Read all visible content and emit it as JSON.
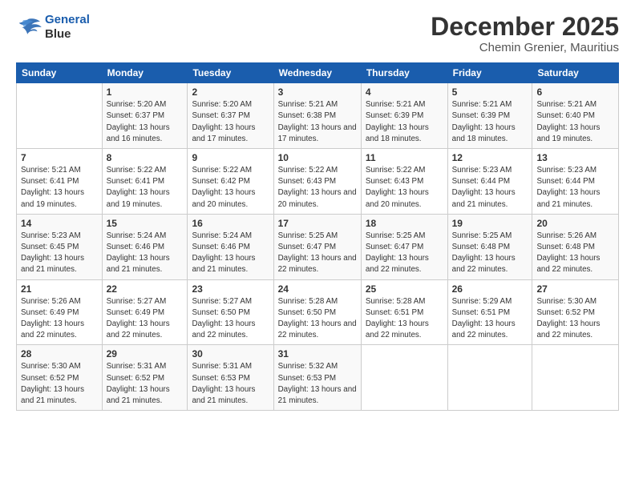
{
  "logo": {
    "line1": "General",
    "line2": "Blue"
  },
  "title": "December 2025",
  "subtitle": "Chemin Grenier, Mauritius",
  "days_of_week": [
    "Sunday",
    "Monday",
    "Tuesday",
    "Wednesday",
    "Thursday",
    "Friday",
    "Saturday"
  ],
  "weeks": [
    [
      {
        "num": "",
        "sunrise": "",
        "sunset": "",
        "daylight": ""
      },
      {
        "num": "1",
        "sunrise": "Sunrise: 5:20 AM",
        "sunset": "Sunset: 6:37 PM",
        "daylight": "Daylight: 13 hours and 16 minutes."
      },
      {
        "num": "2",
        "sunrise": "Sunrise: 5:20 AM",
        "sunset": "Sunset: 6:37 PM",
        "daylight": "Daylight: 13 hours and 17 minutes."
      },
      {
        "num": "3",
        "sunrise": "Sunrise: 5:21 AM",
        "sunset": "Sunset: 6:38 PM",
        "daylight": "Daylight: 13 hours and 17 minutes."
      },
      {
        "num": "4",
        "sunrise": "Sunrise: 5:21 AM",
        "sunset": "Sunset: 6:39 PM",
        "daylight": "Daylight: 13 hours and 18 minutes."
      },
      {
        "num": "5",
        "sunrise": "Sunrise: 5:21 AM",
        "sunset": "Sunset: 6:39 PM",
        "daylight": "Daylight: 13 hours and 18 minutes."
      },
      {
        "num": "6",
        "sunrise": "Sunrise: 5:21 AM",
        "sunset": "Sunset: 6:40 PM",
        "daylight": "Daylight: 13 hours and 19 minutes."
      }
    ],
    [
      {
        "num": "7",
        "sunrise": "Sunrise: 5:21 AM",
        "sunset": "Sunset: 6:41 PM",
        "daylight": "Daylight: 13 hours and 19 minutes."
      },
      {
        "num": "8",
        "sunrise": "Sunrise: 5:22 AM",
        "sunset": "Sunset: 6:41 PM",
        "daylight": "Daylight: 13 hours and 19 minutes."
      },
      {
        "num": "9",
        "sunrise": "Sunrise: 5:22 AM",
        "sunset": "Sunset: 6:42 PM",
        "daylight": "Daylight: 13 hours and 20 minutes."
      },
      {
        "num": "10",
        "sunrise": "Sunrise: 5:22 AM",
        "sunset": "Sunset: 6:43 PM",
        "daylight": "Daylight: 13 hours and 20 minutes."
      },
      {
        "num": "11",
        "sunrise": "Sunrise: 5:22 AM",
        "sunset": "Sunset: 6:43 PM",
        "daylight": "Daylight: 13 hours and 20 minutes."
      },
      {
        "num": "12",
        "sunrise": "Sunrise: 5:23 AM",
        "sunset": "Sunset: 6:44 PM",
        "daylight": "Daylight: 13 hours and 21 minutes."
      },
      {
        "num": "13",
        "sunrise": "Sunrise: 5:23 AM",
        "sunset": "Sunset: 6:44 PM",
        "daylight": "Daylight: 13 hours and 21 minutes."
      }
    ],
    [
      {
        "num": "14",
        "sunrise": "Sunrise: 5:23 AM",
        "sunset": "Sunset: 6:45 PM",
        "daylight": "Daylight: 13 hours and 21 minutes."
      },
      {
        "num": "15",
        "sunrise": "Sunrise: 5:24 AM",
        "sunset": "Sunset: 6:46 PM",
        "daylight": "Daylight: 13 hours and 21 minutes."
      },
      {
        "num": "16",
        "sunrise": "Sunrise: 5:24 AM",
        "sunset": "Sunset: 6:46 PM",
        "daylight": "Daylight: 13 hours and 21 minutes."
      },
      {
        "num": "17",
        "sunrise": "Sunrise: 5:25 AM",
        "sunset": "Sunset: 6:47 PM",
        "daylight": "Daylight: 13 hours and 22 minutes."
      },
      {
        "num": "18",
        "sunrise": "Sunrise: 5:25 AM",
        "sunset": "Sunset: 6:47 PM",
        "daylight": "Daylight: 13 hours and 22 minutes."
      },
      {
        "num": "19",
        "sunrise": "Sunrise: 5:25 AM",
        "sunset": "Sunset: 6:48 PM",
        "daylight": "Daylight: 13 hours and 22 minutes."
      },
      {
        "num": "20",
        "sunrise": "Sunrise: 5:26 AM",
        "sunset": "Sunset: 6:48 PM",
        "daylight": "Daylight: 13 hours and 22 minutes."
      }
    ],
    [
      {
        "num": "21",
        "sunrise": "Sunrise: 5:26 AM",
        "sunset": "Sunset: 6:49 PM",
        "daylight": "Daylight: 13 hours and 22 minutes."
      },
      {
        "num": "22",
        "sunrise": "Sunrise: 5:27 AM",
        "sunset": "Sunset: 6:49 PM",
        "daylight": "Daylight: 13 hours and 22 minutes."
      },
      {
        "num": "23",
        "sunrise": "Sunrise: 5:27 AM",
        "sunset": "Sunset: 6:50 PM",
        "daylight": "Daylight: 13 hours and 22 minutes."
      },
      {
        "num": "24",
        "sunrise": "Sunrise: 5:28 AM",
        "sunset": "Sunset: 6:50 PM",
        "daylight": "Daylight: 13 hours and 22 minutes."
      },
      {
        "num": "25",
        "sunrise": "Sunrise: 5:28 AM",
        "sunset": "Sunset: 6:51 PM",
        "daylight": "Daylight: 13 hours and 22 minutes."
      },
      {
        "num": "26",
        "sunrise": "Sunrise: 5:29 AM",
        "sunset": "Sunset: 6:51 PM",
        "daylight": "Daylight: 13 hours and 22 minutes."
      },
      {
        "num": "27",
        "sunrise": "Sunrise: 5:30 AM",
        "sunset": "Sunset: 6:52 PM",
        "daylight": "Daylight: 13 hours and 22 minutes."
      }
    ],
    [
      {
        "num": "28",
        "sunrise": "Sunrise: 5:30 AM",
        "sunset": "Sunset: 6:52 PM",
        "daylight": "Daylight: 13 hours and 21 minutes."
      },
      {
        "num": "29",
        "sunrise": "Sunrise: 5:31 AM",
        "sunset": "Sunset: 6:52 PM",
        "daylight": "Daylight: 13 hours and 21 minutes."
      },
      {
        "num": "30",
        "sunrise": "Sunrise: 5:31 AM",
        "sunset": "Sunset: 6:53 PM",
        "daylight": "Daylight: 13 hours and 21 minutes."
      },
      {
        "num": "31",
        "sunrise": "Sunrise: 5:32 AM",
        "sunset": "Sunset: 6:53 PM",
        "daylight": "Daylight: 13 hours and 21 minutes."
      },
      {
        "num": "",
        "sunrise": "",
        "sunset": "",
        "daylight": ""
      },
      {
        "num": "",
        "sunrise": "",
        "sunset": "",
        "daylight": ""
      },
      {
        "num": "",
        "sunrise": "",
        "sunset": "",
        "daylight": ""
      }
    ]
  ]
}
